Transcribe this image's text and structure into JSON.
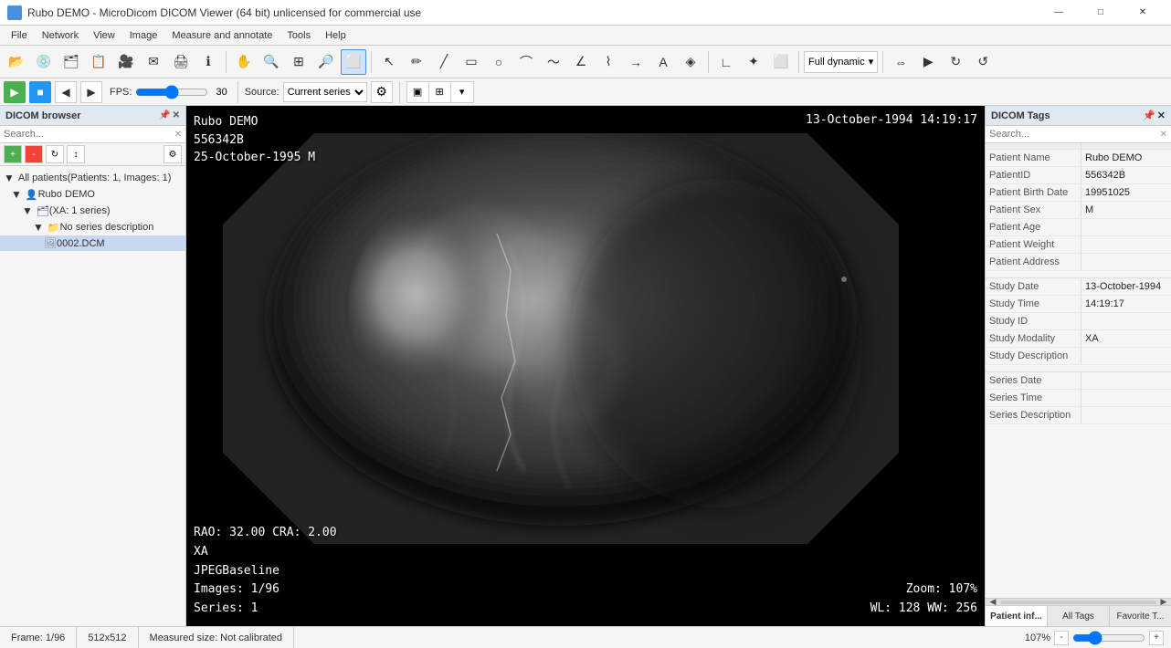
{
  "titlebar": {
    "title": "Rubo DEMO - MicroDicom DICOM Viewer (64 bit) unlicensed for commercial use",
    "min_btn": "—",
    "max_btn": "□",
    "close_btn": "✕"
  },
  "menubar": {
    "items": [
      "File",
      "Network",
      "View",
      "Image",
      "Measure and annotate",
      "Tools",
      "Help"
    ]
  },
  "toolbar1": {
    "window_preset": "Full dynamic",
    "preset_label": "Full dynamic"
  },
  "toolbar2": {
    "fps_label": "FPS:",
    "fps_value": "30",
    "source_label": "Source:",
    "source_value": "Current series"
  },
  "left_panel": {
    "title": "DICOM browser",
    "search_placeholder": "Search...",
    "summary": "All patients(Patients: 1, Images: 1)",
    "patient": "Rubo DEMO",
    "series": "(XA: 1 series)",
    "series_desc": "No series description",
    "file": "0002.DCM"
  },
  "image": {
    "top_left": {
      "line1": "Rubo DEMO",
      "line2": "556342B",
      "line3": "25-October-1995  M"
    },
    "top_right": "13-October-1994  14:19:17",
    "bottom_left": {
      "line1": "RAO: 32.00  CRA: 2.00",
      "line2": "XA",
      "line3": "JPEGBaseline",
      "line4": "Images: 1/96",
      "line5": "Series: 1"
    },
    "bottom_right": {
      "line1": "Zoom: 107%",
      "line2": "WL: 128  WW: 256"
    }
  },
  "right_panel": {
    "title": "DICOM Tags",
    "search_placeholder": "Search...",
    "tags": [
      {
        "name": "Patient Name",
        "value": "Rubo DEMO"
      },
      {
        "name": "PatientID",
        "value": "556342B"
      },
      {
        "name": "Patient Birth Date",
        "value": "19951025"
      },
      {
        "name": "Patient Sex",
        "value": "M"
      },
      {
        "name": "Patient Age",
        "value": ""
      },
      {
        "name": "Patient Weight",
        "value": ""
      },
      {
        "name": "Patient Address",
        "value": ""
      },
      {
        "name": "",
        "value": ""
      },
      {
        "name": "Study Date",
        "value": "13-October-1994"
      },
      {
        "name": "Study Time",
        "value": "14:19:17"
      },
      {
        "name": "Study ID",
        "value": ""
      },
      {
        "name": "Study Modality",
        "value": "XA"
      },
      {
        "name": "Study Description",
        "value": ""
      },
      {
        "name": "",
        "value": ""
      },
      {
        "name": "Series Date",
        "value": ""
      },
      {
        "name": "Series Time",
        "value": ""
      },
      {
        "name": "Series Description",
        "value": ""
      }
    ],
    "tabs": [
      "Patient inf...",
      "All Tags",
      "Favorite T..."
    ]
  },
  "statusbar": {
    "frame": "Frame: 1/96",
    "dimensions": "512x512",
    "calibration": "Measured size: Not calibrated",
    "zoom": "107%"
  }
}
